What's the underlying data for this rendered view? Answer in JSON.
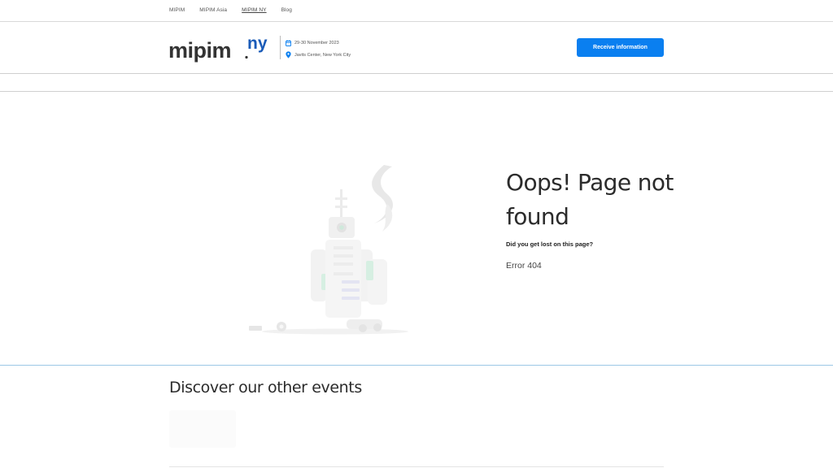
{
  "topnav": {
    "links": [
      "MIPIM",
      "MIPIM Asia",
      "MIPIM NY",
      "Blog"
    ]
  },
  "header": {
    "logo_main": "mipim",
    "logo_sup": "ny",
    "event_date": "29-30 November 2023",
    "event_location": "Javits Center, New York City",
    "cta_label": "Receive information"
  },
  "error": {
    "title": "Oops! Page not found",
    "subtitle": "Did you get lost on this page?",
    "code": "Error 404"
  },
  "discover": {
    "title": "Discover our other events"
  },
  "colors": {
    "accent": "#0a7ff0",
    "logo_dark": "#333333",
    "logo_blue": "#1a5bb8",
    "divider_blue": "#9cc7e6"
  }
}
